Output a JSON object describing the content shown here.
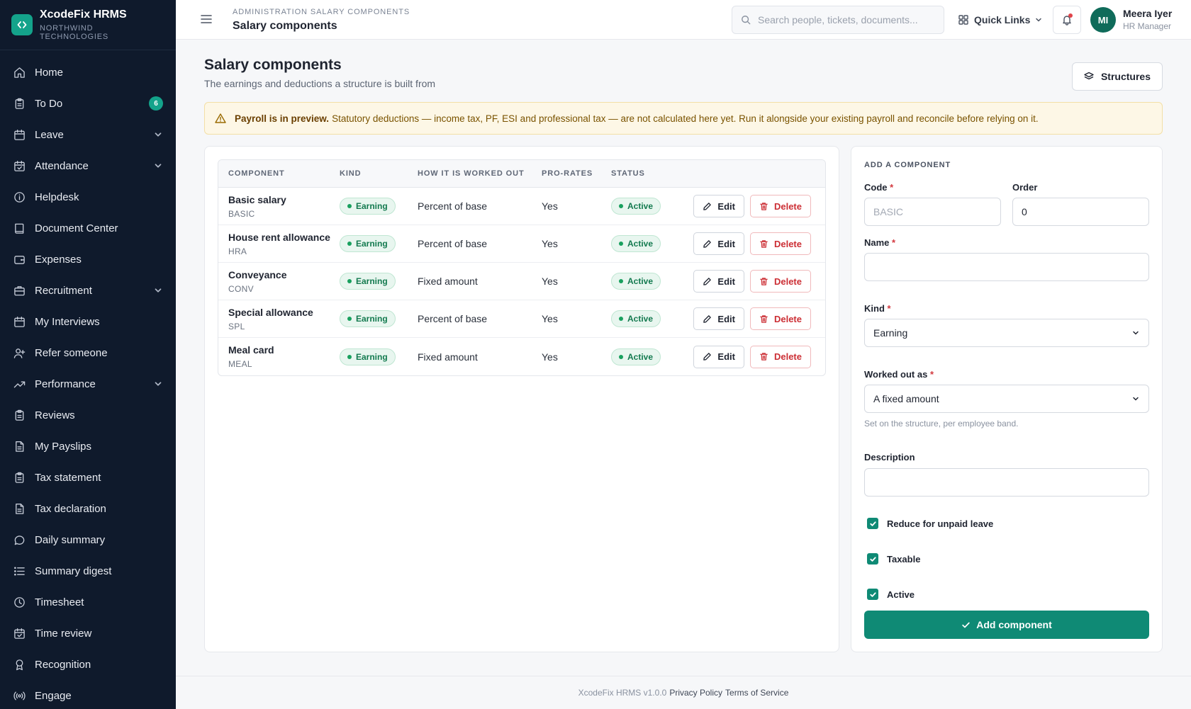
{
  "brand": {
    "name": "XcodeFix HRMS",
    "company": "NORTHWIND TECHNOLOGIES"
  },
  "sidebar": {
    "items": [
      {
        "label": "Home",
        "icon": "home-icon"
      },
      {
        "label": "To Do",
        "icon": "clipboard-icon",
        "badge": "6"
      },
      {
        "label": "Leave",
        "icon": "calendar-icon",
        "expandable": true
      },
      {
        "label": "Attendance",
        "icon": "calendar-check-icon",
        "expandable": true
      },
      {
        "label": "Helpdesk",
        "icon": "info-icon"
      },
      {
        "label": "Document Center",
        "icon": "book-icon"
      },
      {
        "label": "Expenses",
        "icon": "wallet-icon"
      },
      {
        "label": "Recruitment",
        "icon": "briefcase-icon",
        "expandable": true
      },
      {
        "label": "My Interviews",
        "icon": "calendar-icon"
      },
      {
        "label": "Refer someone",
        "icon": "user-plus-icon"
      },
      {
        "label": "Performance",
        "icon": "trending-up-icon",
        "expandable": true
      },
      {
        "label": "Reviews",
        "icon": "clipboard-icon"
      },
      {
        "label": "My Payslips",
        "icon": "file-icon"
      },
      {
        "label": "Tax statement",
        "icon": "clipboard-icon"
      },
      {
        "label": "Tax declaration",
        "icon": "file-icon"
      },
      {
        "label": "Daily summary",
        "icon": "message-icon"
      },
      {
        "label": "Summary digest",
        "icon": "list-icon"
      },
      {
        "label": "Timesheet",
        "icon": "clock-icon"
      },
      {
        "label": "Time review",
        "icon": "calendar-check-icon"
      },
      {
        "label": "Recognition",
        "icon": "award-icon"
      },
      {
        "label": "Engage",
        "icon": "broadcast-icon"
      }
    ]
  },
  "header": {
    "breadcrumb": "ADMINISTRATION SALARY COMPONENTS",
    "title": "Salary components",
    "search_placeholder": "Search people, tickets, documents...",
    "quick_links": "Quick Links",
    "user": {
      "initials": "MI",
      "name": "Meera Iyer",
      "role": "HR Manager"
    }
  },
  "page": {
    "title": "Salary components",
    "subtitle": "The earnings and deductions a structure is built from",
    "structures_button": "Structures",
    "alert_bold": "Payroll is in preview.",
    "alert_text": "Statutory deductions — income tax, PF, ESI and professional tax — are not calculated here yet. Run it alongside your existing payroll and reconcile before relying on it."
  },
  "table": {
    "headers": [
      "COMPONENT",
      "KIND",
      "HOW IT IS WORKED OUT",
      "PRO-RATES",
      "STATUS"
    ],
    "edit_label": "Edit",
    "delete_label": "Delete",
    "rows": [
      {
        "name": "Basic salary",
        "code": "BASIC",
        "kind": "Earning",
        "method": "Percent of base",
        "prorates": "Yes",
        "status": "Active"
      },
      {
        "name": "House rent allowance",
        "code": "HRA",
        "kind": "Earning",
        "method": "Percent of base",
        "prorates": "Yes",
        "status": "Active"
      },
      {
        "name": "Conveyance",
        "code": "CONV",
        "kind": "Earning",
        "method": "Fixed amount",
        "prorates": "Yes",
        "status": "Active"
      },
      {
        "name": "Special allowance",
        "code": "SPL",
        "kind": "Earning",
        "method": "Percent of base",
        "prorates": "Yes",
        "status": "Active"
      },
      {
        "name": "Meal card",
        "code": "MEAL",
        "kind": "Earning",
        "method": "Fixed amount",
        "prorates": "Yes",
        "status": "Active"
      }
    ]
  },
  "form": {
    "section_title": "ADD A COMPONENT",
    "code_label": "Code",
    "code_placeholder": "BASIC",
    "order_label": "Order",
    "order_value": "0",
    "name_label": "Name",
    "name_value": "",
    "kind_label": "Kind",
    "kind_value": "Earning",
    "worked_label": "Worked out as",
    "worked_value": "A fixed amount",
    "worked_help": "Set on the structure, per employee band.",
    "description_label": "Description",
    "description_value": "",
    "required_mark": "*",
    "checkbox_unpaid": "Reduce for unpaid leave",
    "checkbox_taxable": "Taxable",
    "checkbox_active": "Active",
    "submit_label": "Add component"
  },
  "footer": {
    "version": "XcodeFix HRMS v1.0.0",
    "privacy": "Privacy Policy",
    "terms": "Terms of Service"
  },
  "colors": {
    "sidebar_bg": "#0f1a2c",
    "accent": "#0f8a75",
    "danger": "#cc2f35",
    "warning_bg": "#fdf7e6"
  }
}
